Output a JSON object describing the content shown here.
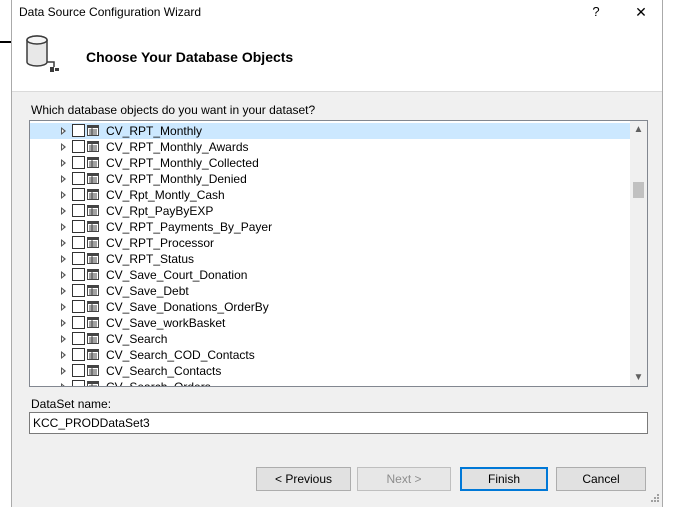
{
  "window": {
    "title": "Data Source Configuration Wizard",
    "help_glyph": "?",
    "close_glyph": "✕"
  },
  "header": {
    "title": "Choose Your Database Objects",
    "icon": "database-connection-icon"
  },
  "question": "Which database objects do you want in your dataset?",
  "tree": {
    "items": [
      {
        "label": "CV_RPT_Monthly",
        "selected": true
      },
      {
        "label": "CV_RPT_Monthly_Awards"
      },
      {
        "label": "CV_RPT_Monthly_Collected"
      },
      {
        "label": "CV_RPT_Monthly_Denied"
      },
      {
        "label": "CV_Rpt_Montly_Cash"
      },
      {
        "label": "CV_Rpt_PayByEXP"
      },
      {
        "label": "CV_RPT_Payments_By_Payer"
      },
      {
        "label": "CV_RPT_Processor"
      },
      {
        "label": "CV_RPT_Status"
      },
      {
        "label": "CV_Save_Court_Donation"
      },
      {
        "label": "CV_Save_Debt"
      },
      {
        "label": "CV_Save_Donations_OrderBy"
      },
      {
        "label": "CV_Save_workBasket"
      },
      {
        "label": "CV_Search"
      },
      {
        "label": "CV_Search_COD_Contacts"
      },
      {
        "label": "CV_Search_Contacts"
      },
      {
        "label": "CV_Search_Orders"
      }
    ],
    "scroll_up_glyph": "▲",
    "scroll_down_glyph": "▼"
  },
  "dataset": {
    "label": "DataSet name:",
    "value": "KCC_PRODDataSet3"
  },
  "buttons": {
    "previous": "< Previous",
    "next": "Next >",
    "finish": "Finish",
    "cancel": "Cancel"
  },
  "colors": {
    "selection": "#cce8ff",
    "accent": "#0078d7",
    "window_bg": "#f0f0f0"
  }
}
